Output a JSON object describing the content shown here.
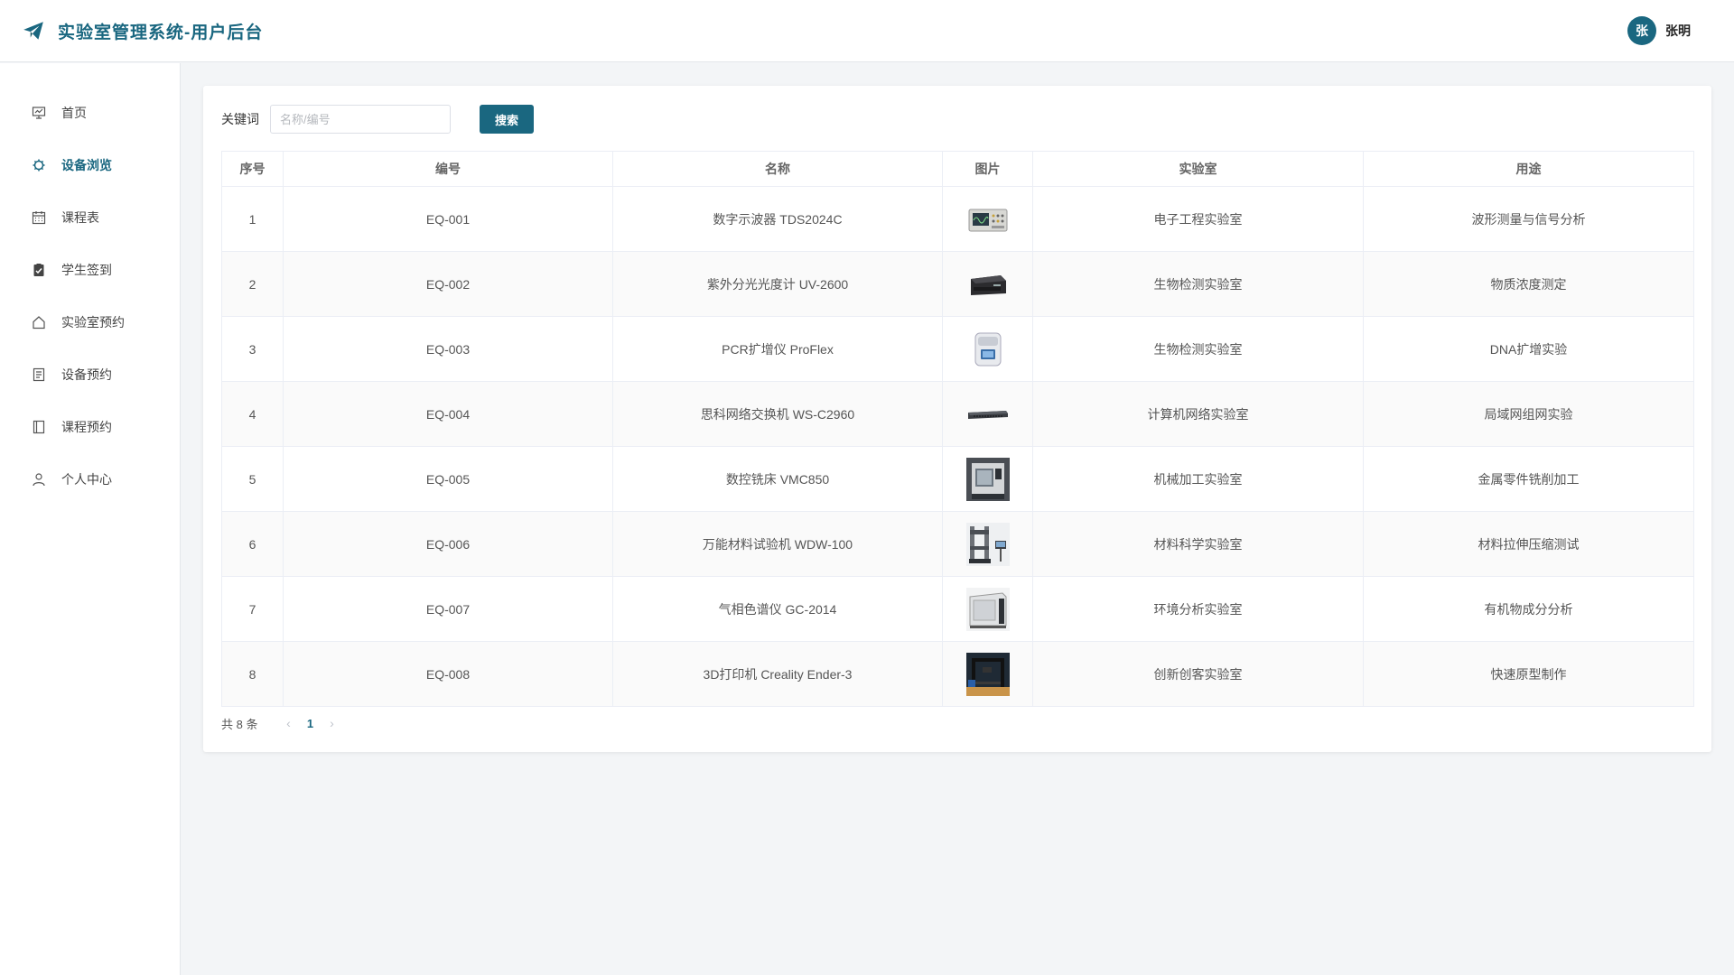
{
  "header": {
    "title": "实验室管理系统-用户后台",
    "logo_icon": "paper-plane-icon",
    "avatar_char": "张",
    "user_name": "张明"
  },
  "colors": {
    "accent": "#1a6780"
  },
  "sidebar": {
    "items": [
      {
        "label": "首页",
        "icon": "chart-board-icon",
        "active": false
      },
      {
        "label": "设备浏览",
        "icon": "chip-icon",
        "active": true
      },
      {
        "label": "课程表",
        "icon": "calendar-icon",
        "active": false
      },
      {
        "label": "学生签到",
        "icon": "clipboard-check-icon",
        "active": false
      },
      {
        "label": "实验室预约",
        "icon": "home-icon",
        "active": false
      },
      {
        "label": "设备预约",
        "icon": "document-icon",
        "active": false
      },
      {
        "label": "课程预约",
        "icon": "notebook-icon",
        "active": false
      },
      {
        "label": "个人中心",
        "icon": "user-icon",
        "active": false
      }
    ]
  },
  "search": {
    "label": "关键词",
    "placeholder": "名称/编号",
    "value": "",
    "button": "搜索"
  },
  "table": {
    "headers": [
      "序号",
      "编号",
      "名称",
      "图片",
      "实验室",
      "用途"
    ],
    "rows": [
      {
        "no": "1",
        "code": "EQ-001",
        "name": "数字示波器 TDS2024C",
        "image": "oscilloscope-image",
        "lab": "电子工程实验室",
        "use": "波形测量与信号分析"
      },
      {
        "no": "2",
        "code": "EQ-002",
        "name": "紫外分光光度计 UV-2600",
        "image": "spectrophotometer-image",
        "lab": "生物检测实验室",
        "use": "物质浓度测定"
      },
      {
        "no": "3",
        "code": "EQ-003",
        "name": "PCR扩增仪 ProFlex",
        "image": "pcr-machine-image",
        "lab": "生物检测实验室",
        "use": "DNA扩增实验"
      },
      {
        "no": "4",
        "code": "EQ-004",
        "name": "思科网络交换机 WS-C2960",
        "image": "network-switch-image",
        "lab": "计算机网络实验室",
        "use": "局域网组网实验"
      },
      {
        "no": "5",
        "code": "EQ-005",
        "name": "数控铣床 VMC850",
        "image": "cnc-mill-image",
        "lab": "机械加工实验室",
        "use": "金属零件铣削加工"
      },
      {
        "no": "6",
        "code": "EQ-006",
        "name": "万能材料试验机 WDW-100",
        "image": "testing-machine-image",
        "lab": "材料科学实验室",
        "use": "材料拉伸压缩测试"
      },
      {
        "no": "7",
        "code": "EQ-007",
        "name": "气相色谱仪 GC-2014",
        "image": "gas-chromatograph-image",
        "lab": "环境分析实验室",
        "use": "有机物成分分析"
      },
      {
        "no": "8",
        "code": "EQ-008",
        "name": "3D打印机 Creality Ender-3",
        "image": "3d-printer-image",
        "lab": "创新创客实验室",
        "use": "快速原型制作"
      }
    ]
  },
  "pagination": {
    "total_text": "共 8 条",
    "current_page": "1",
    "prev": "‹",
    "next": "›"
  }
}
